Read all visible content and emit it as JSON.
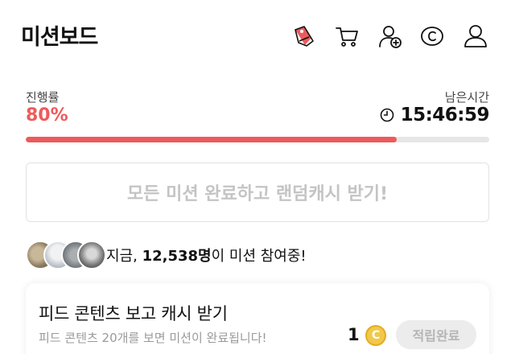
{
  "header": {
    "title": "미션보드",
    "icons": [
      "mission-tag-icon",
      "cart-icon",
      "add-friend-icon",
      "cash-coin-icon",
      "profile-icon"
    ]
  },
  "progress": {
    "label": "진행률",
    "value_text": "80%",
    "percent": 80,
    "color": "#ee5a5a"
  },
  "remaining": {
    "label": "남은시간",
    "time": "15:46:59"
  },
  "cta": {
    "label": "모든 미션 완료하고 랜덤캐시 받기!"
  },
  "participants": {
    "prefix": "지금, ",
    "count": "12,538명",
    "suffix": "이 미션 참여중!"
  },
  "mission_card": {
    "title": "피드 콘텐츠 보고 캐시 받기",
    "description": "피드 콘텐츠 20개를 보면 미션이 완료됩니다!",
    "reward_amount": "1",
    "coin_symbol": "C",
    "button_label": "적립완료"
  }
}
